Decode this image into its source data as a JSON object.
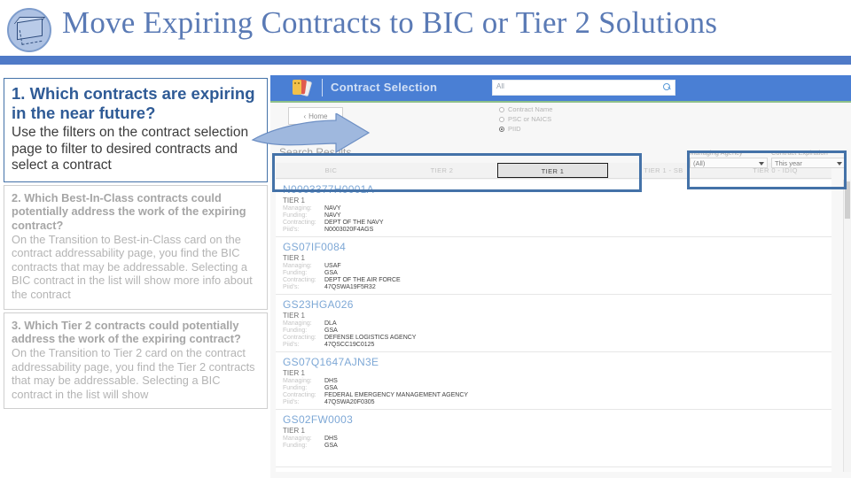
{
  "slide": {
    "title": "Move Expiring Contracts to BIC or Tier 2 Solutions",
    "logo_icon": "box-move-icon",
    "accent_color": "#4f7ac7",
    "title_color": "#5a7ab5"
  },
  "steps": [
    {
      "question": "1. Which contracts are expiring in the near future?",
      "answer": "Use the filters on the contract selection page to filter to desired contracts and select a contract",
      "state": "active"
    },
    {
      "question": "2. Which Best-In-Class contracts could potentially address the work of the expiring contract?",
      "answer": "On the Transition to Best-in-Class card on the contract addressability page, you find the BIC contracts that may be addressable. Selecting a BIC contract in the list will show more info about the contract",
      "state": "muted"
    },
    {
      "question": "3. Which Tier 2 contracts could potentially address the work of the expiring contract?",
      "answer": "On the Transition to Tier 2 card on the contract addressability page, you find the Tier 2 contracts that may be addressable. Selecting a BIC contract in the list will show",
      "state": "muted"
    }
  ],
  "app": {
    "title": "Contract Selection",
    "logo_icon": "card-stack-icon",
    "topbar_color": "#4a7fd4",
    "search": {
      "value": "All",
      "icon": "search-icon"
    },
    "home_button": "Home",
    "home_icon": "chevron-left-icon",
    "search_modes": [
      {
        "label": "Contract Name",
        "selected": false
      },
      {
        "label": "PSC or NAICS",
        "selected": false
      },
      {
        "label": "PIID",
        "selected": true
      }
    ],
    "results_heading": "Search Results",
    "tabs": [
      {
        "label": "BIC",
        "selected": false
      },
      {
        "label": "TIER 2",
        "selected": false
      },
      {
        "label": "TIER 1",
        "selected": true
      },
      {
        "label": "TIER 1 - SB",
        "selected": false
      },
      {
        "label": "TIER 0 - IDIQ",
        "selected": false
      }
    ],
    "filters": [
      {
        "label": "Managing Agency",
        "value": "(All)"
      },
      {
        "label": "Contract Expiration",
        "value": "This year"
      }
    ],
    "field_labels": {
      "tier": "TIER 1",
      "managing": "Managing:",
      "funding": "Funding:",
      "contracting": "Contracting:",
      "piids": "Piid's:"
    },
    "results": [
      {
        "id": "N0003377H0001A",
        "tier": "TIER 1",
        "managing": "NAVY",
        "funding": "NAVY",
        "contracting": "DEPT OF THE NAVY",
        "piids": "N0003020F4AGS"
      },
      {
        "id": "GS07IF0084",
        "tier": "TIER 1",
        "managing": "USAF",
        "funding": "GSA",
        "contracting": "DEPT OF THE AIR FORCE",
        "piids": "47QSWA19F5R32"
      },
      {
        "id": "GS23HGA026",
        "tier": "TIER 1",
        "managing": "DLA",
        "funding": "GSA",
        "contracting": "DEFENSE LOGISTICS AGENCY",
        "piids": "47QSCC19C0125"
      },
      {
        "id": "GS07Q1647AJN3E",
        "tier": "TIER 1",
        "managing": "DHS",
        "funding": "GSA",
        "contracting": "FEDERAL EMERGENCY MANAGEMENT AGENCY",
        "piids": "47QSWA20F0305"
      },
      {
        "id": "GS02FW0003",
        "tier": "TIER 1",
        "managing": "DHS",
        "funding": "GSA",
        "contracting": "",
        "piids": ""
      }
    ],
    "highlight_color": "#4472a8"
  }
}
